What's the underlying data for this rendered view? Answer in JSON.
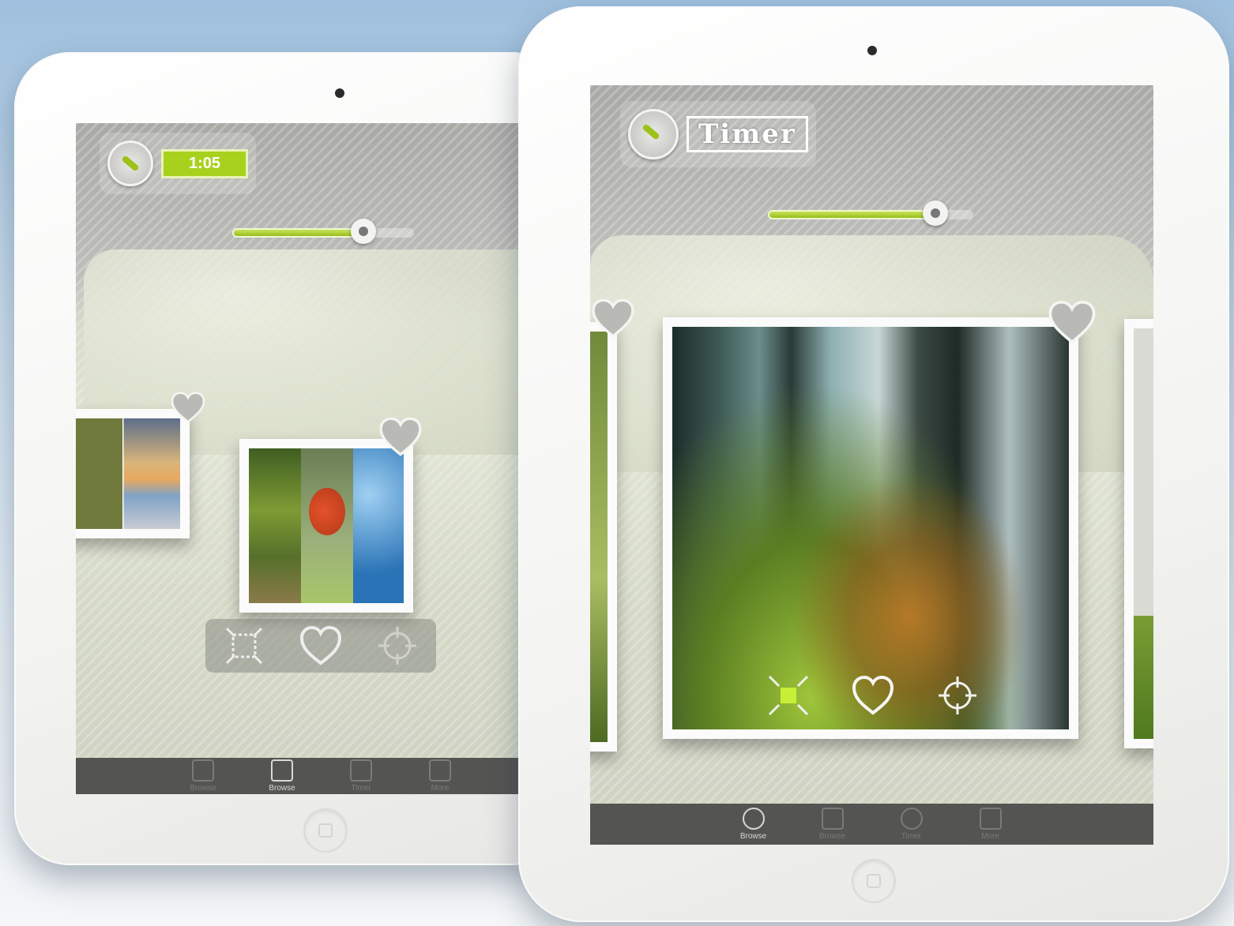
{
  "back_device": {
    "timer_value": "1:05",
    "slider_level": 0.8,
    "tabs": [
      {
        "label": "Browse",
        "icon": "clock-icon",
        "active": false
      },
      {
        "label": "Browse",
        "icon": "puzzle-icon",
        "active": true
      },
      {
        "label": "Timer",
        "icon": "timer-icon",
        "active": false
      },
      {
        "label": "More",
        "icon": "grid-icon",
        "active": false
      }
    ],
    "actions": [
      "expand-icon",
      "heart-icon",
      "target-icon"
    ]
  },
  "front_device": {
    "timer_label": "Timer",
    "slider_level": 0.82,
    "tabs": [
      {
        "label": "Browse",
        "icon": "clock-icon",
        "active": true
      },
      {
        "label": "Browse",
        "icon": "puzzle-icon",
        "active": false
      },
      {
        "label": "Timer",
        "icon": "timer-icon",
        "active": false
      },
      {
        "label": "More",
        "icon": "grid-icon",
        "active": false
      }
    ],
    "actions": [
      "expand-icon",
      "heart-icon",
      "target-icon"
    ]
  },
  "colors": {
    "accent": "#a8d11e",
    "tabbar": "#545452",
    "device_body": "#f3f3f1"
  }
}
